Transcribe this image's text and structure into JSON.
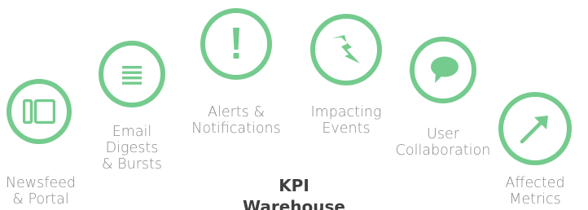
{
  "colors": {
    "ring": "#74cb8d",
    "label": "#8b8b8b",
    "title": "#3f3f3f"
  },
  "items": [
    {
      "icon": "newsfeed-portal-icon",
      "lines": [
        "Newsfeed",
        "& Portal"
      ]
    },
    {
      "icon": "email-digest-icon",
      "lines": [
        "Email",
        "Digests",
        "& Bursts"
      ]
    },
    {
      "icon": "alert-exclamation-icon",
      "lines": [
        "Alerts &",
        "Notifications"
      ]
    },
    {
      "icon": "lightning-bolt-icon",
      "lines": [
        "Impacting",
        "Events"
      ]
    },
    {
      "icon": "speech-bubble-icon",
      "lines": [
        "User",
        "Collaboration"
      ]
    },
    {
      "icon": "trend-arrow-icon",
      "lines": [
        "Affected",
        "Metrics"
      ]
    }
  ],
  "center": {
    "line1": "KPI",
    "line2": "Warehouse"
  }
}
